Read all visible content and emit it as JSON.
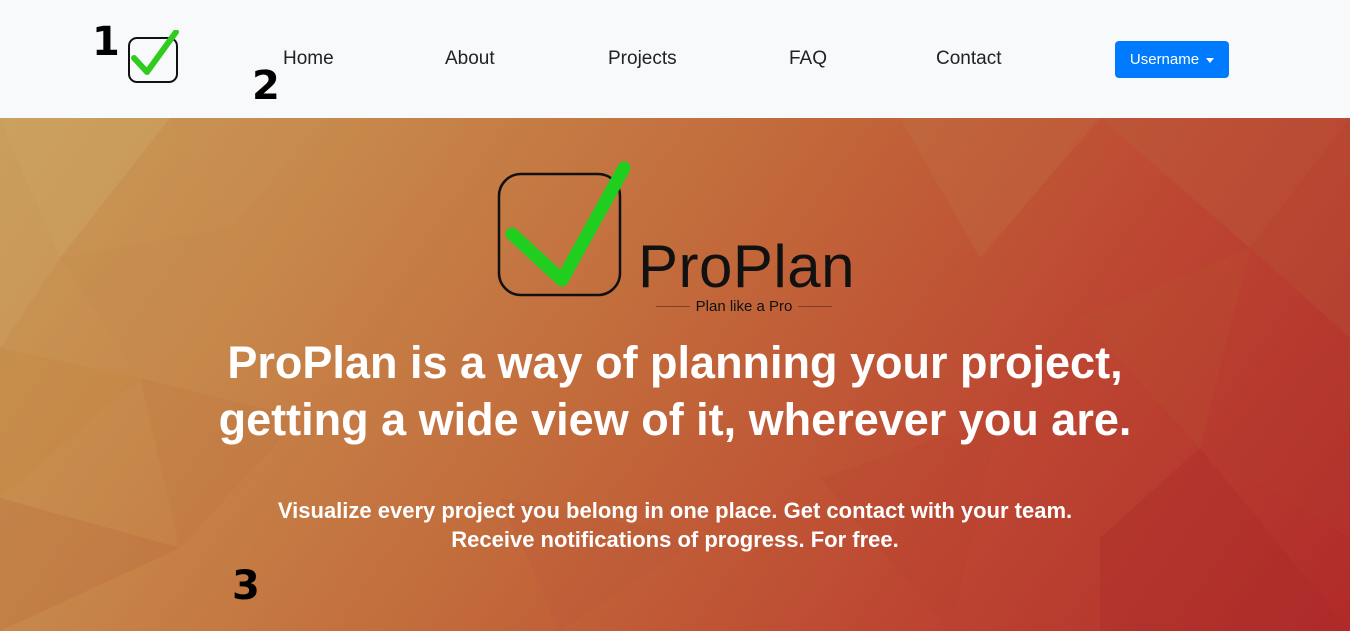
{
  "nav": {
    "links": [
      "Home",
      "About",
      "Projects",
      "FAQ",
      "Contact"
    ],
    "user_button": "Username"
  },
  "markers": [
    "1",
    "2",
    "3"
  ],
  "hero": {
    "brand_name": "ProPlan",
    "tagline": "Plan like a Pro",
    "headline_line1": "ProPlan is a way of planning your project,",
    "headline_line2": "getting a wide view of it, wherever you are.",
    "sub_line1": "Visualize every project you belong in one place. Get contact with your team.",
    "sub_line2": "Receive notifications of progress. For free."
  },
  "icons": {
    "logo": "checkbox-check-icon",
    "dropdown": "caret-down-icon"
  },
  "colors": {
    "navbar_bg": "#f8f9fa",
    "button_blue": "#007bff",
    "check_green": "#2fcc1f",
    "hero_gradient_start": "#c89c58",
    "hero_gradient_end": "#b12a2a"
  }
}
